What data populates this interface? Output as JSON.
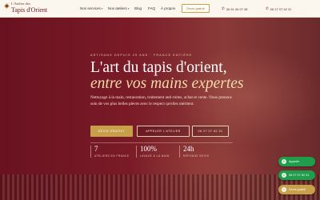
{
  "header": {
    "logo": {
      "line1": "L'Atelier des",
      "line2": "Tapis d'Orient"
    },
    "nav": [
      {
        "label": "Nos services",
        "has_dropdown": true
      },
      {
        "label": "Nos ateliers",
        "has_dropdown": true
      },
      {
        "label": "Blog",
        "has_dropdown": false
      },
      {
        "label": "FAQ",
        "has_dropdown": false
      },
      {
        "label": "À propos",
        "has_dropdown": false
      }
    ],
    "quote_button": "Devis gratuit",
    "phones": [
      {
        "number": "06 51 06 07 38",
        "icon": "phone-icon"
      },
      {
        "number": "06 27 07 62 31",
        "icon": "phone-icon"
      }
    ]
  },
  "hero": {
    "eyebrow": "ARTISANS DEPUIS 25 ANS · FRANCE ENTIÈRE",
    "title_line1": "L'art du tapis d'orient,",
    "title_line2": "entre vos mains expertes",
    "description": "Nettoyage à la main, restauration, traitement anti-mites, achat et vente. Nous prenons soin de vos plus belles pièces avec le respect qu'elles méritent.",
    "buttons": {
      "primary": "DEVIS GRATUIT",
      "secondary": "APPELER L'ATELIER",
      "phone": "06 27 07 62 31"
    },
    "stats": [
      {
        "value": "7",
        "label": "ATELIERS EN FRANCE"
      },
      {
        "value": "100%",
        "label": "LAVAGE À LA MAIN"
      },
      {
        "value": "24h",
        "label": "RÉPONSE DEVIS"
      }
    ]
  },
  "floating": {
    "call_label": "Appeler",
    "phone_label": "06 27 07 62 31",
    "quote_label": "Devis gratuit"
  },
  "colors": {
    "accent_gold": "#c8a04a",
    "hero_burgundy": "#6a1220",
    "cta_green": "#1f9d4a",
    "header_bg": "#fbf7ef"
  }
}
